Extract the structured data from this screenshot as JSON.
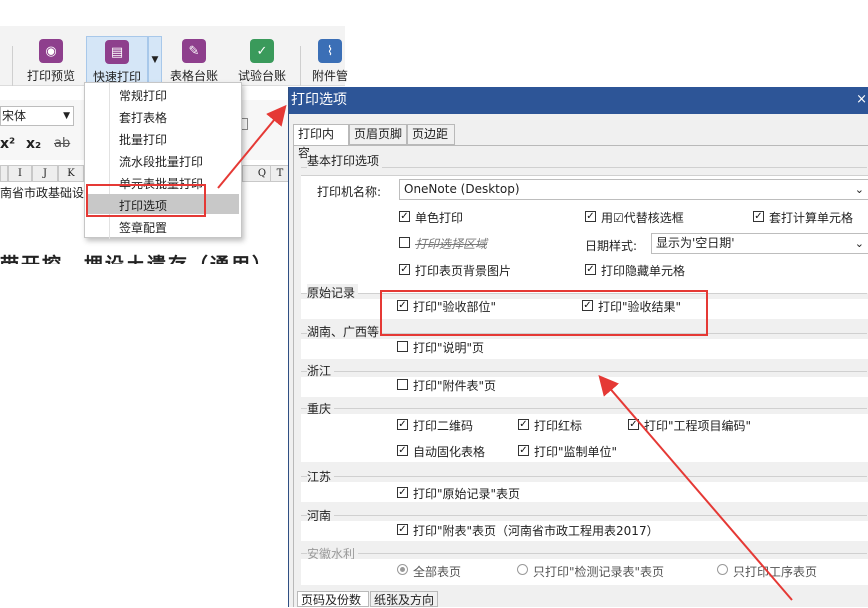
{
  "ribbon": {
    "items": [
      {
        "label": "打印预览",
        "icon": "eye-icon",
        "color": "#8e3f8d"
      },
      {
        "label": "快速打印",
        "icon": "printer-icon",
        "color": "#8e3f8d"
      },
      {
        "label": "表格台账",
        "icon": "ledger-icon",
        "color": "#8e3f8d"
      },
      {
        "label": "试验台账",
        "icon": "calendar-check-icon",
        "color": "#3a9a5b"
      },
      {
        "label": "附件管",
        "icon": "paperclip-icon",
        "color": "#3b6fb6"
      }
    ]
  },
  "formatbar": {
    "font": "宋体",
    "superscript": "x²",
    "subscript": "x₂",
    "strike": "ab",
    "columns": [
      "I",
      "J",
      "K",
      "Q",
      "T"
    ],
    "sheet_text": "南省市政基础设",
    "heading_text": "带开挖、埋设土遗存（通用）"
  },
  "menu": {
    "items": [
      "常规打印",
      "套打表格",
      "批量打印",
      "流水段批量打印",
      "单元表批量打印",
      "打印选项",
      "签章配置"
    ],
    "selected": "打印选项"
  },
  "dialog": {
    "title": "打印选项",
    "tabs": [
      "打印内容",
      "页眉页脚",
      "页边距"
    ],
    "active_tab": "打印内容",
    "basic_group": "基本打印选项",
    "printer_label": "打印机名称:",
    "printer_value": "OneNote (Desktop)",
    "options": {
      "mono": {
        "label": "单色打印",
        "checked": true
      },
      "replace_check": {
        "label": "用☑代替核选框",
        "checked": true
      },
      "overlay_calc": {
        "label": "套打计算单元格",
        "checked": true
      },
      "print_selection": {
        "label": "打印选择区域",
        "checked": false
      },
      "bg_image": {
        "label": "打印表页背景图片",
        "checked": true
      },
      "hidden_cells": {
        "label": "打印隐藏单元格",
        "checked": true
      }
    },
    "date_label": "日期样式:",
    "date_value": "显示为'空日期'",
    "groups": {
      "raw": {
        "label": "原始记录",
        "opt1": "打印\"验收部位\"",
        "opt2": "打印\"验收结果\""
      },
      "hunan": {
        "label": "湖南、广西等",
        "opt1": "打印\"说明\"页"
      },
      "zhejiang": {
        "label": "浙江",
        "opt1": "打印\"附件表\"页"
      },
      "chongqing": {
        "label": "重庆",
        "opt1": "打印二维码",
        "opt2": "打印红标",
        "opt3": "打印\"工程项目编码\"",
        "opt4": "自动固化表格",
        "opt5": "打印\"监制单位\""
      },
      "jiangsu": {
        "label": "江苏",
        "opt1": "打印\"原始记录\"表页"
      },
      "henan": {
        "label": "河南",
        "opt1": "打印\"附表\"表页（河南省市政工程用表2017）"
      },
      "anhui": {
        "label": "安徽水利",
        "opt1": "全部表页",
        "opt2": "只打印\"检测记录表\"表页",
        "opt3": "只打印工序表页"
      }
    },
    "bottom_tabs": [
      "页码及份数",
      "纸张及方向"
    ]
  },
  "colors": {
    "title_bar": "#2d5597",
    "annotation": "#e53935"
  }
}
